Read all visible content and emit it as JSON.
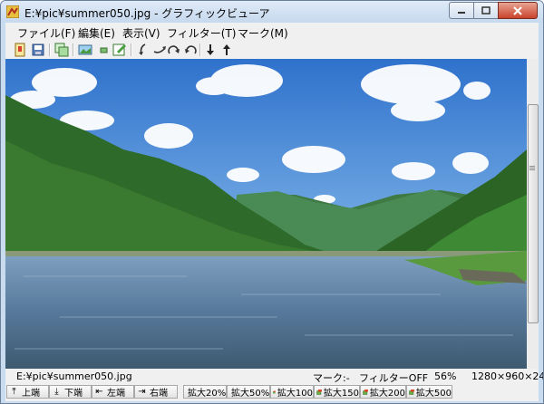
{
  "window": {
    "title": "E:¥pic¥summer050.jpg - グラフィックビューア"
  },
  "menu": [
    {
      "label": "ファイル(F)"
    },
    {
      "label": "編集(E)"
    },
    {
      "label": "表示(V)"
    },
    {
      "label": "フィルター(T)"
    },
    {
      "label": "マーク(M)"
    }
  ],
  "toolbar": {
    "icons": [
      "open-icon",
      "save-icon",
      "copy-icon",
      "image-icon",
      "small-image-icon",
      "edit-icon",
      "rotate-left-icon",
      "rotate-right-icon",
      "redo-icon",
      "undo-icon",
      "down-arrow-icon",
      "up-arrow-icon"
    ]
  },
  "status": {
    "path": "E:¥pic¥summer050.jpg",
    "mark": "マーク:-",
    "filter": "フィルターOFF",
    "zoom": "56%",
    "size": "1280×960×24"
  },
  "bottom_buttons": [
    {
      "label": "上端",
      "icon": "top-arrow-icon"
    },
    {
      "label": "下端",
      "icon": "bottom-arrow-icon"
    },
    {
      "label": "左端",
      "icon": "left-arrow-icon"
    },
    {
      "label": "右端",
      "icon": "right-arrow-icon"
    },
    {
      "label": "拡大20%",
      "icon": "zoom-20-icon"
    },
    {
      "label": "拡大50%",
      "icon": "zoom-50-icon"
    },
    {
      "label": "拡大100",
      "icon": "zoom-100-icon"
    },
    {
      "label": "拡大150",
      "icon": "zoom-150-icon"
    },
    {
      "label": "拡大200",
      "icon": "zoom-200-icon"
    },
    {
      "label": "拡大500",
      "icon": "zoom-500-icon"
    }
  ],
  "colors": {
    "title_bar": "#c9dbef",
    "close_button": "#c9432c",
    "sky": "#3a7fd0",
    "river": "#5b7d9e",
    "hills": "#2f6a2a"
  }
}
